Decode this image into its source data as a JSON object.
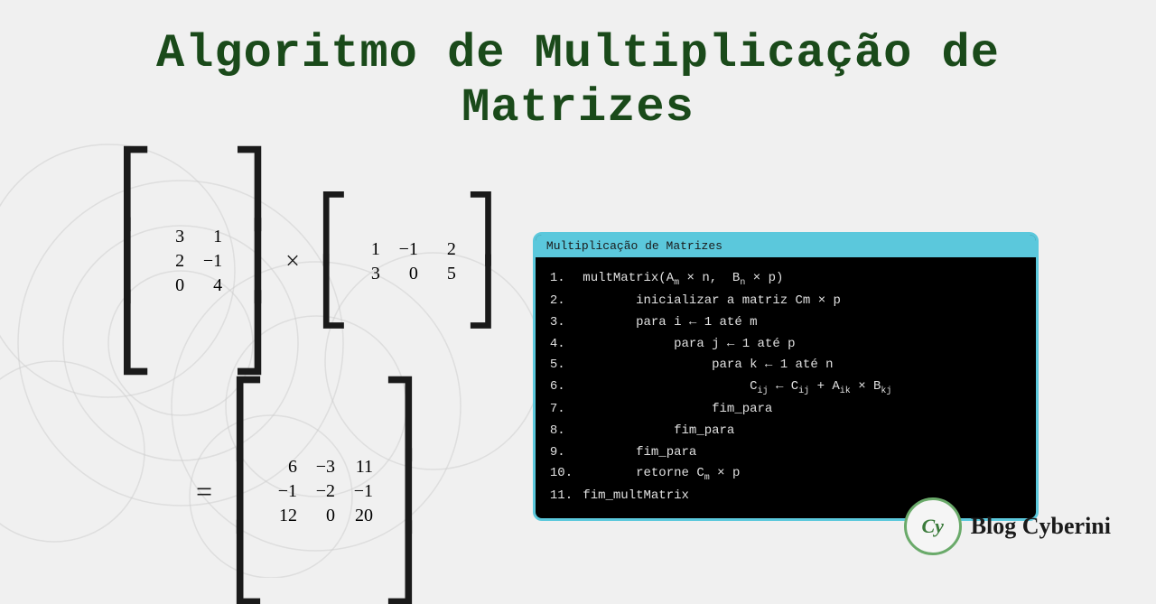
{
  "title": {
    "line1": "Algoritmo de Multiplicação de",
    "line2": "Matrizes"
  },
  "code_block": {
    "title": "Multiplicação de Matrizes",
    "lines": [
      {
        "num": "1.",
        "content": " multMatrix(A"
      },
      {
        "num": "2.",
        "content": "        inicializar a matriz Cm × p"
      },
      {
        "num": "3.",
        "content": "        para i ← 1 até m"
      },
      {
        "num": "4.",
        "content": "             para j ← 1 até p"
      },
      {
        "num": "5.",
        "content": "                  para k ← 1 até n"
      },
      {
        "num": "6.",
        "content": "                       C"
      },
      {
        "num": "7.",
        "content": "                  fim_para"
      },
      {
        "num": "8.",
        "content": "             fim_para"
      },
      {
        "num": "9.",
        "content": "        fim_para"
      },
      {
        "num": "10.",
        "content": "        retorne C"
      },
      {
        "num": "11.",
        "content": " fim_multMatrix"
      }
    ]
  },
  "logo": {
    "cy": "Cy",
    "text": "Blog Cyberini"
  },
  "matrix_a": {
    "rows": [
      [
        "3",
        "1"
      ],
      [
        "2",
        "−1"
      ],
      [
        "0",
        "4"
      ]
    ]
  },
  "matrix_b": {
    "rows": [
      [
        "1",
        "−1",
        "2"
      ],
      [
        "3",
        "0",
        "5"
      ]
    ]
  },
  "matrix_c": {
    "rows": [
      [
        "6",
        "−3",
        "11"
      ],
      [
        "−1",
        "−2",
        "−1"
      ],
      [
        "12",
        "0",
        "20"
      ]
    ]
  }
}
